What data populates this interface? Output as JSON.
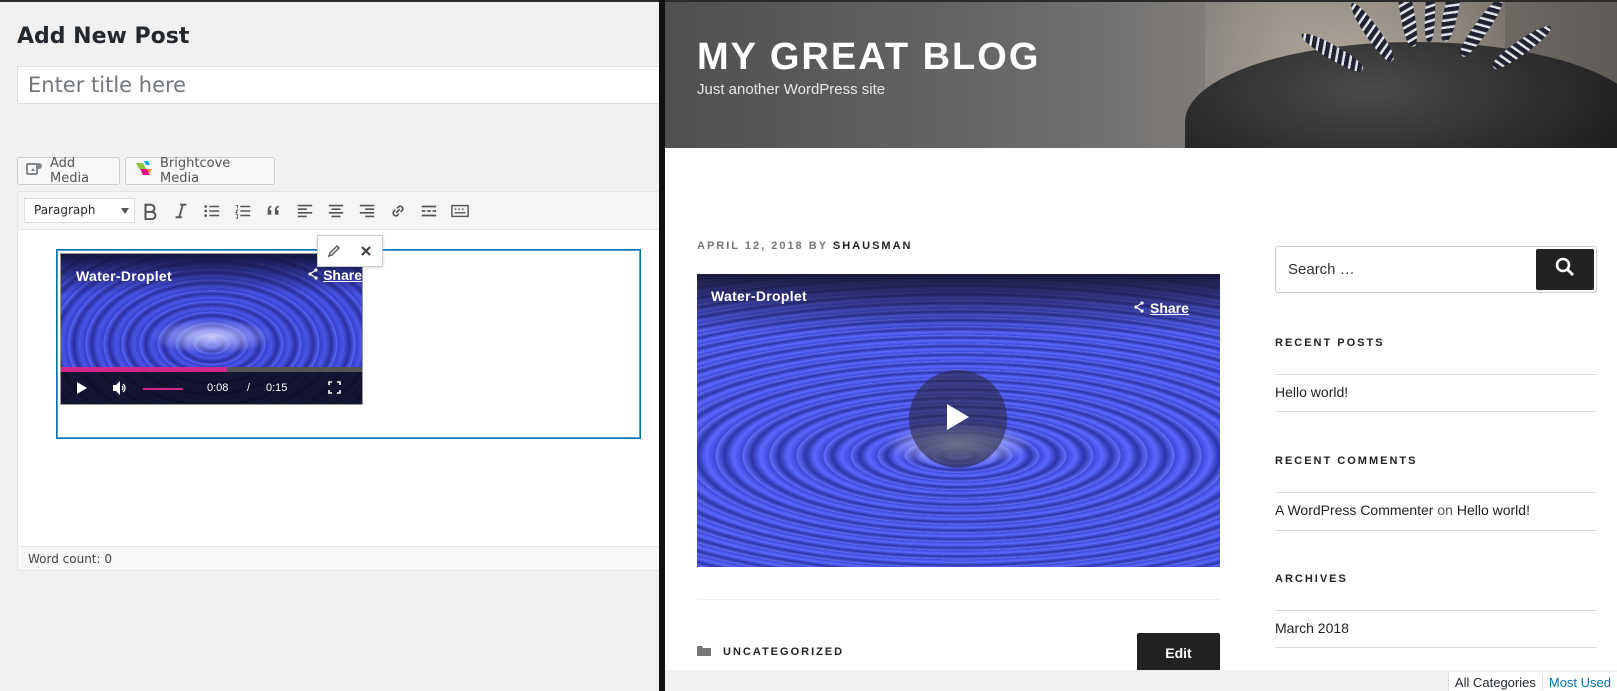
{
  "editor": {
    "page_heading": "Add New Post",
    "title_placeholder": "Enter title here",
    "add_media_label": "Add Media",
    "brightcove_label": "Brightcove Media",
    "format_value": "Paragraph",
    "word_count": "Word count: 0",
    "mini_player": {
      "title": "Water-Droplet",
      "share_label": "Share",
      "current_time": "0:08",
      "separator": "/",
      "duration": "0:15",
      "progress": 0.55
    },
    "toolbar_icons": [
      "bold-icon",
      "italic-icon",
      "bullet-list-icon",
      "numbered-list-icon",
      "blockquote-icon",
      "align-left-icon",
      "align-center-icon",
      "align-right-icon",
      "link-icon",
      "read-more-icon",
      "toolbar-toggle-icon"
    ]
  },
  "blog": {
    "site_title": "MY GREAT BLOG",
    "tagline": "Just another WordPress site",
    "post_date": "APRIL 12, 2018",
    "by_label": "BY",
    "author": "SHAUSMAN",
    "video_title": "Water-Droplet",
    "share_label": "Share",
    "category": "UNCATEGORIZED",
    "edit_label": "Edit",
    "sidebar": {
      "search_placeholder": "Search …",
      "recent_posts_title": "RECENT POSTS",
      "recent_posts": [
        "Hello world!"
      ],
      "recent_comments_title": "RECENT COMMENTS",
      "comment_author": "A WordPress Commenter",
      "comment_on": "on",
      "comment_post": "Hello world!",
      "archives_title": "ARCHIVES",
      "archives": [
        "March 2018"
      ]
    },
    "category_tabs": [
      "All Categories",
      "Most Used"
    ]
  },
  "colors": {
    "wp_blue": "#0073aa",
    "progress_pink": "#d0278a",
    "dark_button": "#222222"
  }
}
